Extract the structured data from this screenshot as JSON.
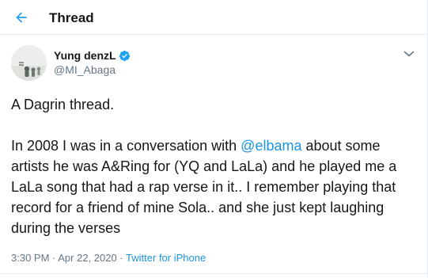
{
  "header": {
    "title": "Thread",
    "back_icon": "arrow-left-icon",
    "accent_color": "#1da1f2"
  },
  "tweet": {
    "author": {
      "name": "Yung denzL",
      "handle": "@MI_Abaga",
      "verified": true,
      "avatar_icon": "avatar-photo"
    },
    "text": {
      "line1": "A Dagrin thread.",
      "para2_before": "In 2008 I was in a conversation with ",
      "mention": "@elbama",
      "para2_after": " about some artists he was A&Ring for (YQ and LaLa) and he played me a LaLa song that had a rap verse in it.. I remember playing that record for a friend of mine Sola.. and she just kept laughing during the verses"
    },
    "meta": {
      "time": "3:30 PM",
      "sep": " · ",
      "date": "Apr 22, 2020",
      "source": "Twitter for iPhone"
    },
    "more_icon": "chevron-down-icon"
  },
  "colors": {
    "link": "#1b95e0",
    "secondary_text": "#657786",
    "primary_text": "#14171a",
    "divider": "#e6ecf0"
  }
}
